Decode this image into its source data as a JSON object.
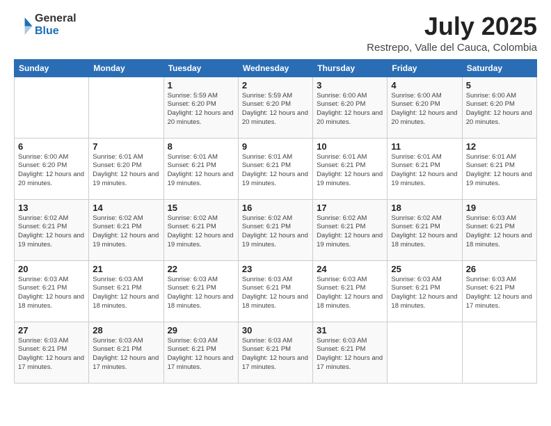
{
  "logo": {
    "general": "General",
    "blue": "Blue"
  },
  "header": {
    "month": "July 2025",
    "location": "Restrepo, Valle del Cauca, Colombia"
  },
  "weekdays": [
    "Sunday",
    "Monday",
    "Tuesday",
    "Wednesday",
    "Thursday",
    "Friday",
    "Saturday"
  ],
  "weeks": [
    [
      {
        "day": "",
        "info": ""
      },
      {
        "day": "",
        "info": ""
      },
      {
        "day": "1",
        "info": "Sunrise: 5:59 AM\nSunset: 6:20 PM\nDaylight: 12 hours and 20 minutes."
      },
      {
        "day": "2",
        "info": "Sunrise: 5:59 AM\nSunset: 6:20 PM\nDaylight: 12 hours and 20 minutes."
      },
      {
        "day": "3",
        "info": "Sunrise: 6:00 AM\nSunset: 6:20 PM\nDaylight: 12 hours and 20 minutes."
      },
      {
        "day": "4",
        "info": "Sunrise: 6:00 AM\nSunset: 6:20 PM\nDaylight: 12 hours and 20 minutes."
      },
      {
        "day": "5",
        "info": "Sunrise: 6:00 AM\nSunset: 6:20 PM\nDaylight: 12 hours and 20 minutes."
      }
    ],
    [
      {
        "day": "6",
        "info": "Sunrise: 6:00 AM\nSunset: 6:20 PM\nDaylight: 12 hours and 20 minutes."
      },
      {
        "day": "7",
        "info": "Sunrise: 6:01 AM\nSunset: 6:20 PM\nDaylight: 12 hours and 19 minutes."
      },
      {
        "day": "8",
        "info": "Sunrise: 6:01 AM\nSunset: 6:21 PM\nDaylight: 12 hours and 19 minutes."
      },
      {
        "day": "9",
        "info": "Sunrise: 6:01 AM\nSunset: 6:21 PM\nDaylight: 12 hours and 19 minutes."
      },
      {
        "day": "10",
        "info": "Sunrise: 6:01 AM\nSunset: 6:21 PM\nDaylight: 12 hours and 19 minutes."
      },
      {
        "day": "11",
        "info": "Sunrise: 6:01 AM\nSunset: 6:21 PM\nDaylight: 12 hours and 19 minutes."
      },
      {
        "day": "12",
        "info": "Sunrise: 6:01 AM\nSunset: 6:21 PM\nDaylight: 12 hours and 19 minutes."
      }
    ],
    [
      {
        "day": "13",
        "info": "Sunrise: 6:02 AM\nSunset: 6:21 PM\nDaylight: 12 hours and 19 minutes."
      },
      {
        "day": "14",
        "info": "Sunrise: 6:02 AM\nSunset: 6:21 PM\nDaylight: 12 hours and 19 minutes."
      },
      {
        "day": "15",
        "info": "Sunrise: 6:02 AM\nSunset: 6:21 PM\nDaylight: 12 hours and 19 minutes."
      },
      {
        "day": "16",
        "info": "Sunrise: 6:02 AM\nSunset: 6:21 PM\nDaylight: 12 hours and 19 minutes."
      },
      {
        "day": "17",
        "info": "Sunrise: 6:02 AM\nSunset: 6:21 PM\nDaylight: 12 hours and 19 minutes."
      },
      {
        "day": "18",
        "info": "Sunrise: 6:02 AM\nSunset: 6:21 PM\nDaylight: 12 hours and 18 minutes."
      },
      {
        "day": "19",
        "info": "Sunrise: 6:03 AM\nSunset: 6:21 PM\nDaylight: 12 hours and 18 minutes."
      }
    ],
    [
      {
        "day": "20",
        "info": "Sunrise: 6:03 AM\nSunset: 6:21 PM\nDaylight: 12 hours and 18 minutes."
      },
      {
        "day": "21",
        "info": "Sunrise: 6:03 AM\nSunset: 6:21 PM\nDaylight: 12 hours and 18 minutes."
      },
      {
        "day": "22",
        "info": "Sunrise: 6:03 AM\nSunset: 6:21 PM\nDaylight: 12 hours and 18 minutes."
      },
      {
        "day": "23",
        "info": "Sunrise: 6:03 AM\nSunset: 6:21 PM\nDaylight: 12 hours and 18 minutes."
      },
      {
        "day": "24",
        "info": "Sunrise: 6:03 AM\nSunset: 6:21 PM\nDaylight: 12 hours and 18 minutes."
      },
      {
        "day": "25",
        "info": "Sunrise: 6:03 AM\nSunset: 6:21 PM\nDaylight: 12 hours and 18 minutes."
      },
      {
        "day": "26",
        "info": "Sunrise: 6:03 AM\nSunset: 6:21 PM\nDaylight: 12 hours and 17 minutes."
      }
    ],
    [
      {
        "day": "27",
        "info": "Sunrise: 6:03 AM\nSunset: 6:21 PM\nDaylight: 12 hours and 17 minutes."
      },
      {
        "day": "28",
        "info": "Sunrise: 6:03 AM\nSunset: 6:21 PM\nDaylight: 12 hours and 17 minutes."
      },
      {
        "day": "29",
        "info": "Sunrise: 6:03 AM\nSunset: 6:21 PM\nDaylight: 12 hours and 17 minutes."
      },
      {
        "day": "30",
        "info": "Sunrise: 6:03 AM\nSunset: 6:21 PM\nDaylight: 12 hours and 17 minutes."
      },
      {
        "day": "31",
        "info": "Sunrise: 6:03 AM\nSunset: 6:21 PM\nDaylight: 12 hours and 17 minutes."
      },
      {
        "day": "",
        "info": ""
      },
      {
        "day": "",
        "info": ""
      }
    ]
  ]
}
